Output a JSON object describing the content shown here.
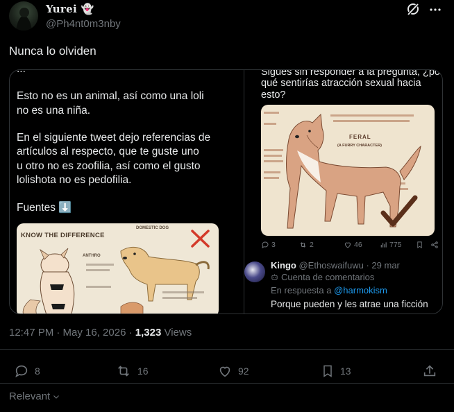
{
  "author": {
    "display_name": "Yurei 👻",
    "handle": "@Ph4nt0m3nby"
  },
  "tweet": {
    "text": "Nunca lo olviden",
    "time": "12:47 PM · May 16, 2026 · ",
    "views_count": "1,323",
    "views_label": "Views"
  },
  "media_left": {
    "cut_line": "...",
    "para1_l1": "Esto no es un animal, así como una loli",
    "para1_l2": "no es una niña.",
    "para2_l1": "En el siguiente tweet dejo referencias de",
    "para2_l2": "artículos al respecto, que te guste uno",
    "para2_l3": "u otro no es zoofilia, así como el gusto",
    "para2_l4": "lolishota no es pedofilia.",
    "sources": "Fuentes ⬇️",
    "graphic_title": "KNOW THE DIFFERENCE",
    "graphic_tag_domestic": "DOMESTIC DOG",
    "graphic_tag_anthro": "ANTHRO"
  },
  "media_right": {
    "q_l1": "Sigues sin responder a la pregunta, ¿por",
    "q_l2": "qué sentirías atracción sexual hacia",
    "q_l3": "esto?",
    "graphic_label": "FERAL",
    "graphic_sub": "(A FURRY CHARACTER)",
    "stats": {
      "replies": "3",
      "reposts": "2",
      "likes": "46",
      "views": "775"
    },
    "reply": {
      "name": "Kingo",
      "handle": "@Ethoswaifuwu · 29 mar",
      "account_type": "Cuenta de comentarios",
      "in_reply_prefix": "En respuesta a",
      "in_reply_handle": "@harmokism",
      "text": "Porque pueden y les atrae una ficción"
    }
  },
  "actions": {
    "replies": "8",
    "reposts": "16",
    "likes": "92",
    "bookmarks": "13"
  },
  "sort": {
    "label": "Relevant"
  },
  "colors": {
    "background": "#000000",
    "text": "#e7e9ea",
    "muted": "#71767b",
    "border": "#2f3336",
    "link": "#1d9bf0"
  }
}
